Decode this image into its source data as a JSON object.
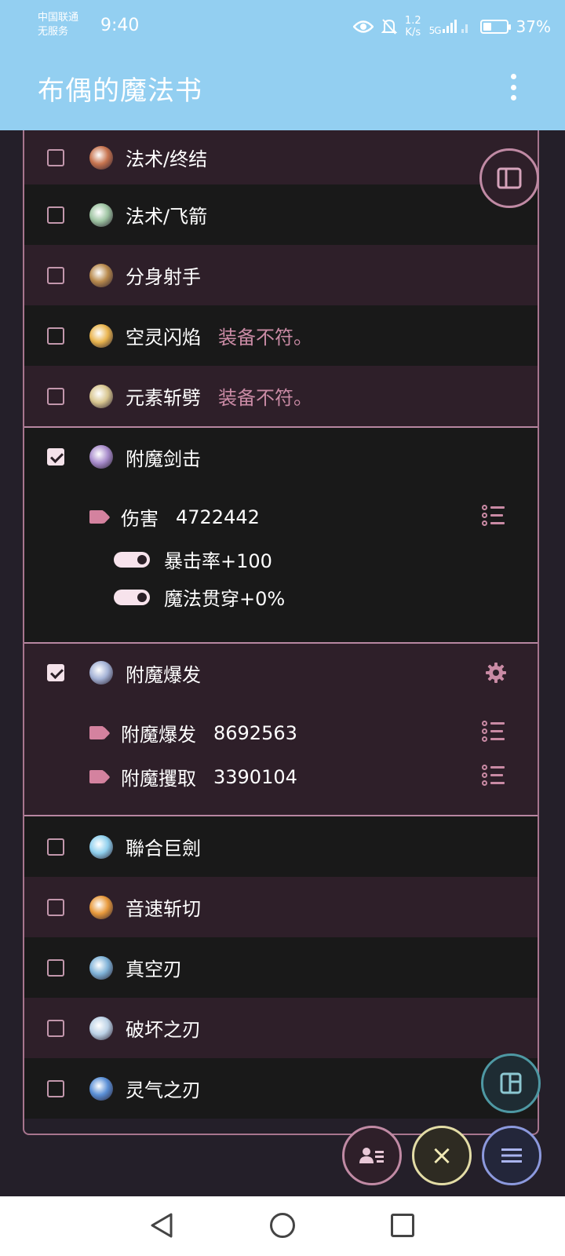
{
  "status_bar": {
    "carrier": "中国联通",
    "service": "无服务",
    "time": "9:40",
    "net_speed_value": "1.2",
    "net_speed_unit": "K/s",
    "signal": "5G",
    "battery_pct": "37%",
    "battery_level": 0.37
  },
  "app": {
    "title": "布偶的魔法书"
  },
  "skills": [
    {
      "label": "法术/终结",
      "note": "",
      "checked": false,
      "icon": "finisher-skill-icon",
      "color": "#c7744f"
    },
    {
      "label": "法术/飞箭",
      "note": "",
      "checked": false,
      "icon": "arrow-skill-icon",
      "color": "#9ec4a2"
    },
    {
      "label": "分身射手",
      "note": "",
      "checked": false,
      "icon": "clone-archer-skill-icon",
      "color": "#b88a4d"
    },
    {
      "label": "空灵闪焰",
      "note": "装备不符。",
      "checked": false,
      "icon": "ethereal-flame-skill-icon",
      "color": "#e9b44e"
    },
    {
      "label": "元素斩劈",
      "note": "装备不符。",
      "checked": false,
      "icon": "element-slash-skill-icon",
      "color": "#d8c690"
    },
    {
      "label": "附魔剑击",
      "checked": true,
      "icon": "enchant-sword-skill-icon",
      "color": "#a98dcc",
      "damage": {
        "name": "伤害",
        "value": "4722442"
      },
      "toggles": [
        "暴击率+100",
        "魔法贯穿+0%"
      ]
    },
    {
      "label": "附魔爆发",
      "checked": true,
      "icon": "enchant-burst-skill-icon",
      "color": "#a5b3d6",
      "effects": [
        {
          "name": "附魔爆发",
          "value": "8692563"
        },
        {
          "name": "附魔攫取",
          "value": "3390104"
        }
      ]
    },
    {
      "label": "聯合巨劍",
      "note": "",
      "checked": false,
      "icon": "united-greatsword-skill-icon",
      "color": "#8fd0ee"
    },
    {
      "label": "音速斩切",
      "note": "",
      "checked": false,
      "icon": "sonic-slash-skill-icon",
      "color": "#e89a3c"
    },
    {
      "label": "真空刃",
      "note": "",
      "checked": false,
      "icon": "vacuum-blade-skill-icon",
      "color": "#7fb2d8"
    },
    {
      "label": "破坏之刃",
      "note": "",
      "checked": false,
      "icon": "destruction-blade-skill-icon",
      "color": "#bcd2e6"
    },
    {
      "label": "灵气之刃",
      "note": "",
      "checked": false,
      "icon": "aura-blade-skill-icon",
      "color": "#5a8fd6"
    }
  ],
  "buttons": {
    "close_symbol": "×"
  },
  "colors": {
    "app_bar": "#93cff1",
    "background": "#241f29",
    "row_purple": "#2e1f29",
    "row_dark": "#191919",
    "accent_pink": "#c98aa4",
    "border": "#b786a1"
  }
}
